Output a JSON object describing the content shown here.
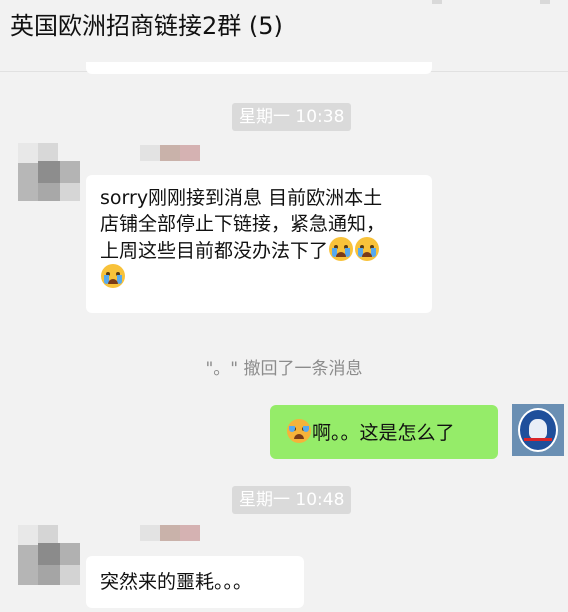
{
  "header": {
    "title": "英国欧洲招商链接2群 (5)"
  },
  "messages": [
    {
      "type": "timestamp",
      "text": "星期一 10:38"
    },
    {
      "type": "incoming",
      "text": "sorry刚刚接到消息 目前欧洲本土\n店铺全部停止下链接，紧急通知，\n上周这些目前都没办法下了",
      "emojis": [
        "loudly-crying-face",
        "loudly-crying-face",
        "loudly-crying-face"
      ]
    },
    {
      "type": "recall",
      "text": "\"。\" 撤回了一条消息"
    },
    {
      "type": "outgoing",
      "emoji": "rolling-laughing-face",
      "text": "啊。。这是怎么了",
      "avatar": "chelsea-crest-avatar"
    },
    {
      "type": "timestamp",
      "text": "星期一 10:48"
    },
    {
      "type": "incoming",
      "text": "突然来的噩耗。。。"
    }
  ],
  "colors": {
    "background": "#f2f2f2",
    "incoming_bubble": "#ffffff",
    "outgoing_bubble": "#95ec69",
    "timestamp_bg": "#dadada",
    "recall_text": "#8c8c8c"
  }
}
